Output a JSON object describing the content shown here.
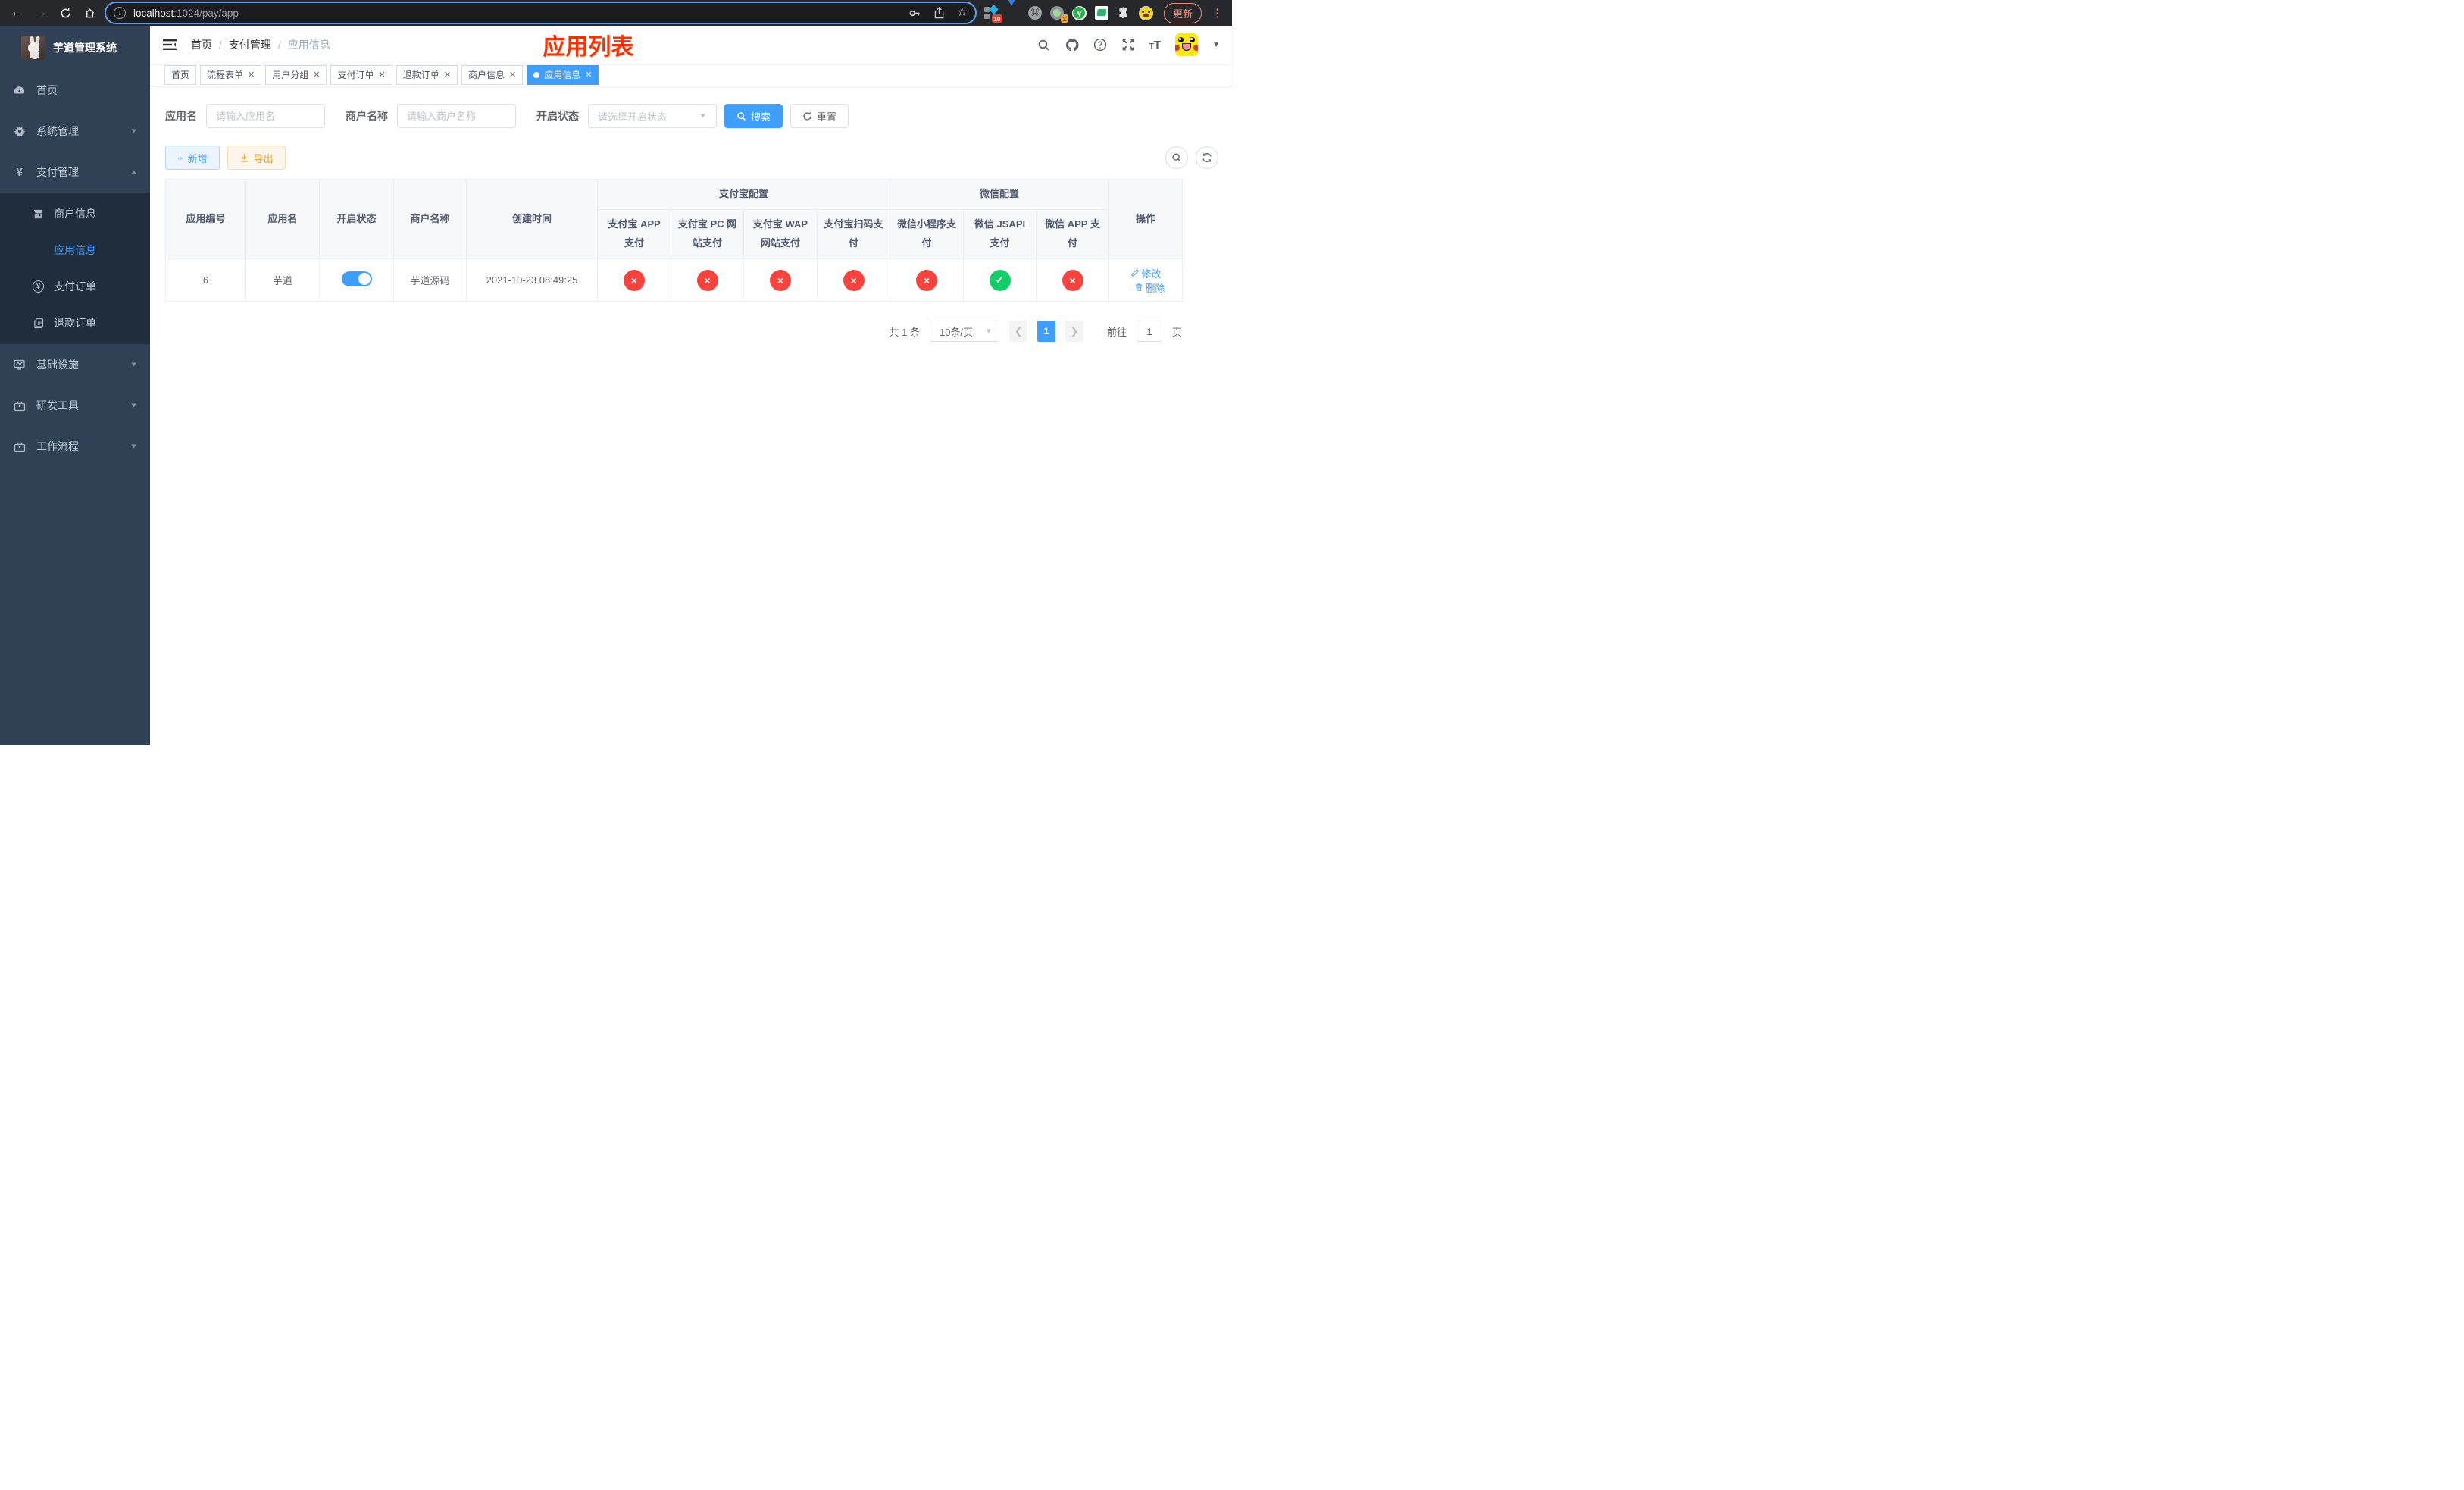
{
  "browser": {
    "url_host": "localhost",
    "url_rest": ":1024/pay/app",
    "update_label": "更新",
    "ext_badges": {
      "pinned_count": "10",
      "proxy_count": "1"
    },
    "ext_y_letter": "y"
  },
  "sidebar": {
    "title": "芋道管理系统",
    "menu": [
      {
        "label": "首页"
      },
      {
        "label": "系统管理"
      },
      {
        "label": "支付管理"
      },
      {
        "label": "基础设施"
      },
      {
        "label": "研发工具"
      },
      {
        "label": "工作流程"
      }
    ],
    "submenu": [
      {
        "label": "商户信息"
      },
      {
        "label": "应用信息"
      },
      {
        "label": "支付订单"
      },
      {
        "label": "退款订单"
      }
    ]
  },
  "header": {
    "breadcrumb": [
      "首页",
      "支付管理",
      "应用信息"
    ],
    "page_title": "应用列表"
  },
  "tabs": [
    {
      "label": "首页",
      "closable": false,
      "active": false
    },
    {
      "label": "流程表单",
      "closable": true,
      "active": false
    },
    {
      "label": "用户分组",
      "closable": true,
      "active": false
    },
    {
      "label": "支付订单",
      "closable": true,
      "active": false
    },
    {
      "label": "退款订单",
      "closable": true,
      "active": false
    },
    {
      "label": "商户信息",
      "closable": true,
      "active": false
    },
    {
      "label": "应用信息",
      "closable": true,
      "active": true
    }
  ],
  "filters": {
    "app_name": {
      "label": "应用名",
      "placeholder": "请输入应用名"
    },
    "merchant_name": {
      "label": "商户名称",
      "placeholder": "请输入商户名称"
    },
    "status": {
      "label": "开启状态",
      "placeholder": "请选择开启状态"
    },
    "search_label": "搜索",
    "reset_label": "重置"
  },
  "toolbar": {
    "add_label": "新增",
    "export_label": "导出"
  },
  "table": {
    "groups": {
      "alipay": "支付宝配置",
      "wechat": "微信配置"
    },
    "columns": {
      "id": "应用编号",
      "name": "应用名",
      "status": "开启状态",
      "merchant": "商户名称",
      "create_time": "创建时间",
      "alipay_app": "支付宝 APP 支付",
      "alipay_pc": "支付宝 PC 网站支付",
      "alipay_wap": "支付宝 WAP 网站支付",
      "alipay_qr": "支付宝扫码支付",
      "wx_lite": "微信小程序支付",
      "wx_jsapi": "微信 JSAPI 支付",
      "wx_app": "微信 APP 支付",
      "actions": "操作"
    },
    "rows": [
      {
        "id": "6",
        "name": "芋道",
        "enabled": true,
        "merchant": "芋道源码",
        "create_time": "2021-10-23 08:49:25",
        "channels": {
          "alipay_app": false,
          "alipay_pc": false,
          "alipay_wap": false,
          "alipay_qr": false,
          "wx_lite": false,
          "wx_jsapi": true,
          "wx_app": false
        },
        "edit_label": "修改",
        "delete_label": "删除"
      }
    ]
  },
  "pagination": {
    "total_text": "共 1 条",
    "page_size": "10条/页",
    "current_page": "1",
    "goto_label": "前往",
    "goto_value": "1",
    "page_unit": "页"
  },
  "colors": {
    "primary": "#409eff",
    "success": "#13ce66",
    "danger": "#f8433d",
    "warning": "#e6a23c",
    "title_red": "#ff3000",
    "sidebar_bg": "#304156",
    "submenu_bg": "#1f2d3d"
  }
}
